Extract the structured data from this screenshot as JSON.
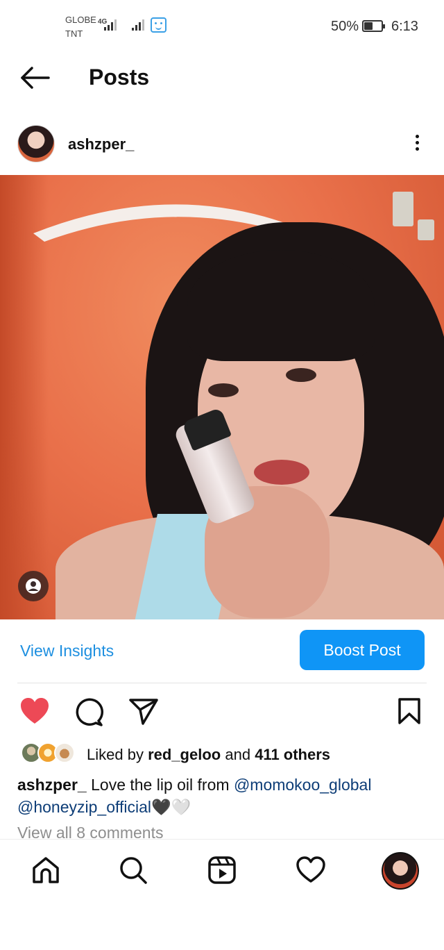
{
  "status_bar": {
    "carrier_line1": "GLOBE",
    "carrier_line2": "TNT",
    "network_type": "4G",
    "battery_percent_text": "50%",
    "battery_level": 0.5,
    "time": "6:13"
  },
  "header": {
    "title": "Posts"
  },
  "post": {
    "username": "ashzper_",
    "view_insights_label": "View Insights",
    "boost_label": "Boost Post",
    "liked_by_prefix": "Liked by",
    "liked_by_user": "red_geloo",
    "liked_by_conjunction": "and",
    "liked_by_others": "411 others",
    "caption_user": "ashzper_",
    "caption_text": "Love the lip oil from",
    "mention_1": "@momokoo_global",
    "mention_2": "@honeyzip_official",
    "caption_emojis": "🖤🤍",
    "view_comments": "View all 8 comments",
    "liked": true
  },
  "colors": {
    "accent_blue": "#0f95f6",
    "link_blue": "#1d8fe0",
    "like_red": "#ed4956",
    "mention_navy": "#0d3d77"
  }
}
